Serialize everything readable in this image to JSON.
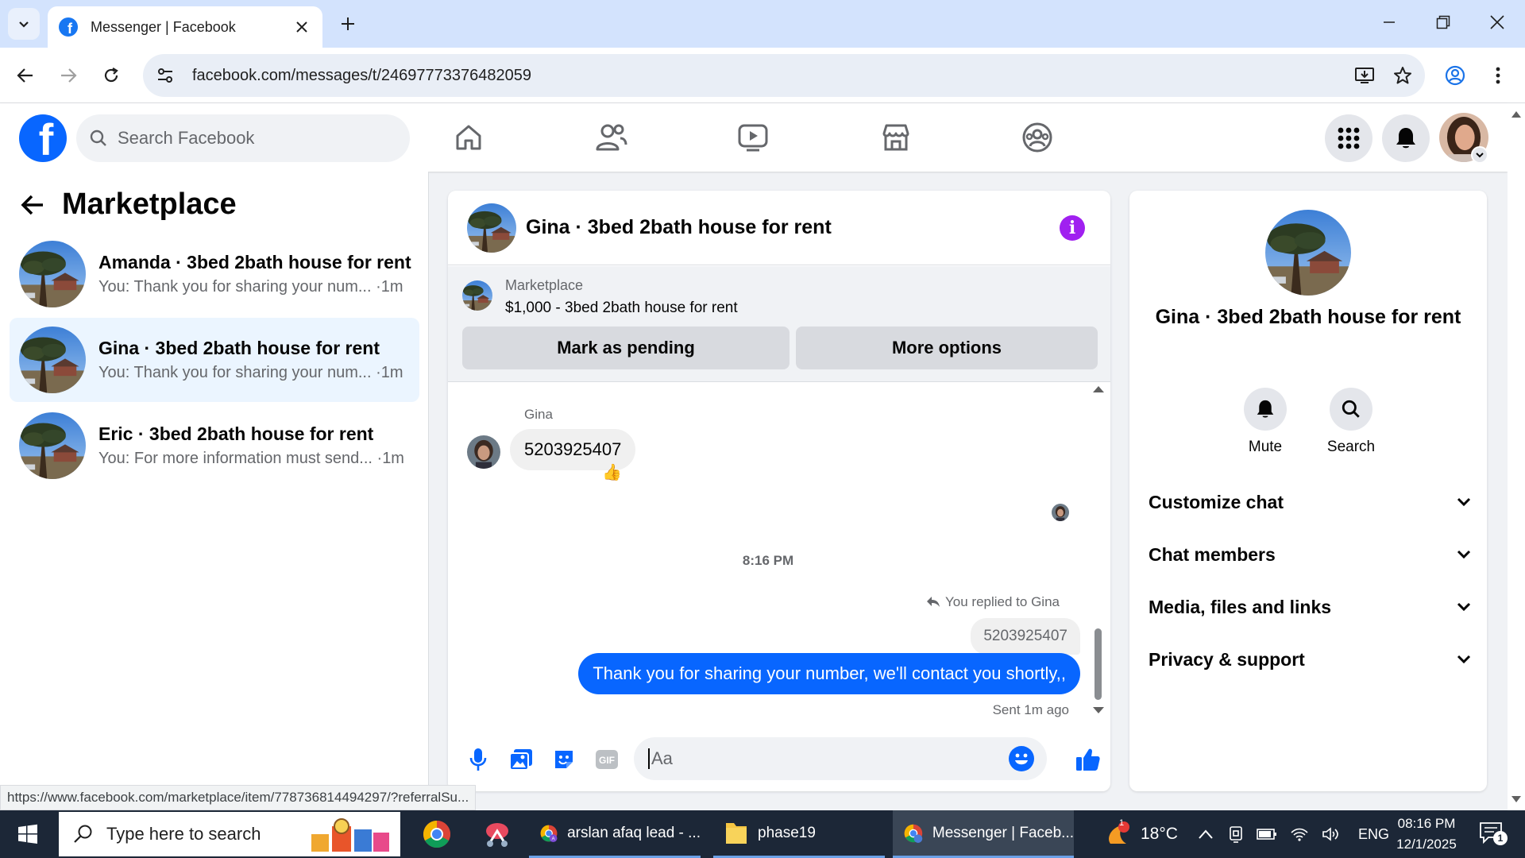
{
  "browser": {
    "tab_title": "Messenger | Facebook",
    "url": "facebook.com/messages/t/24697773376482059",
    "status_url": "https://www.facebook.com/marketplace/item/778736814494297/?referralSu..."
  },
  "fb_header": {
    "search_placeholder": "Search Facebook"
  },
  "left": {
    "title": "Marketplace",
    "conversations": [
      {
        "name": "Amanda · 3bed 2bath house for rent",
        "preview": "You: Thank you for sharing your num... ·1m",
        "active": false
      },
      {
        "name": "Gina · 3bed 2bath house for rent",
        "preview": "You: Thank you for sharing your num... ·1m",
        "active": true
      },
      {
        "name": "Eric · 3bed 2bath house for rent",
        "preview": "You: For more information must send... ·1m",
        "active": false
      }
    ]
  },
  "chat": {
    "title": "Gina · 3bed 2bath house for rent",
    "listing": {
      "category": "Marketplace",
      "price_title": "$1,000 - 3bed 2bath house for rent",
      "mark_pending_label": "Mark as pending",
      "more_options_label": "More options"
    },
    "messages": {
      "sender_name": "Gina",
      "received_text": "5203925407",
      "reaction": "👍",
      "timestamp": "8:16 PM",
      "replied_label": "You replied to Gina",
      "quoted_text": "5203925407",
      "sent_text": "Thank you for sharing your number, we'll contact you shortly,,",
      "sent_status": "Sent 1m ago"
    },
    "composer_placeholder": "Aa"
  },
  "info_panel": {
    "name": "Gina · 3bed 2bath house for rent",
    "actions": [
      {
        "label": "Mute",
        "icon": "bell-icon"
      },
      {
        "label": "Search",
        "icon": "search-icon"
      }
    ],
    "sections": [
      "Customize chat",
      "Chat members",
      "Media, files and links",
      "Privacy & support"
    ]
  },
  "taskbar": {
    "search_placeholder": "Type here to search",
    "apps": [
      {
        "label": "",
        "icon": "chrome-icon"
      },
      {
        "label": "",
        "icon": "snip-icon"
      },
      {
        "label": "arslan afaq lead - ...",
        "icon": "chrome-profile-icon"
      },
      {
        "label": "phase19",
        "icon": "folder-icon"
      },
      {
        "label": "Messenger | Faceb...",
        "icon": "chrome-profile-icon"
      }
    ],
    "weather": "18°C",
    "weather_badge": "1",
    "language": "ENG",
    "time": "08:16 PM",
    "date": "12/1/2025",
    "notification_count": "1"
  },
  "colors": {
    "fb_blue": "#0866ff",
    "active_conv": "#ebf5ff",
    "info_purple": "#a020f0",
    "tab_strip": "#d3e3fd",
    "taskbar": "#1c2737"
  }
}
